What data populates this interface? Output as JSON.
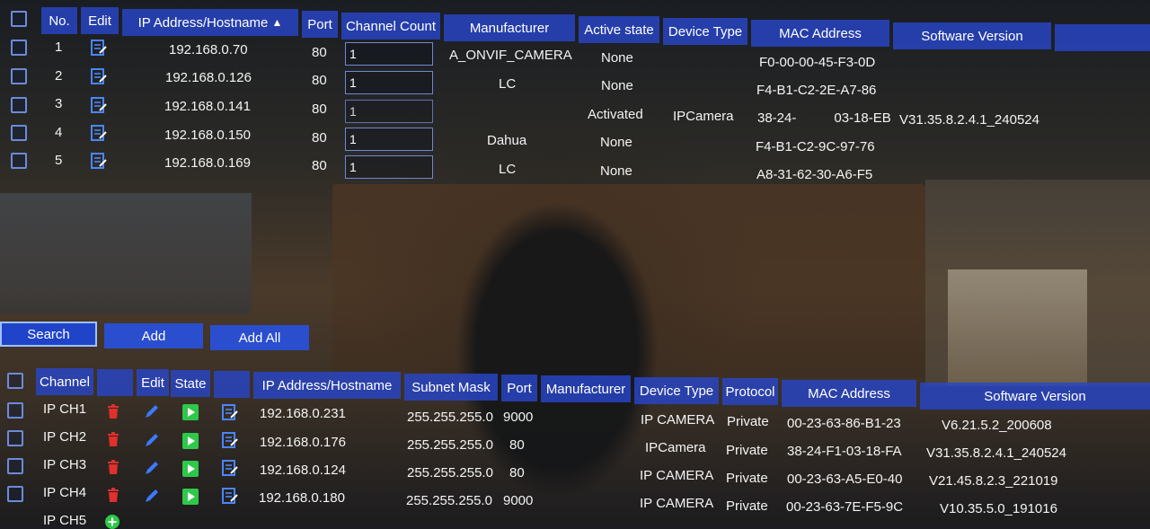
{
  "top_table": {
    "headers": {
      "no": "No.",
      "edit": "Edit",
      "ip": "IP Address/Hostname",
      "sort_arrow": "^",
      "port": "Port",
      "channel_count": "Channel Count",
      "manufacturer": "Manufacturer",
      "active_state": "Active state",
      "device_type": "Device Type",
      "mac": "MAC Address",
      "software": "Software Version"
    },
    "rows": [
      {
        "no": "1",
        "ip": "192.168.0.70",
        "port": "80",
        "channel_count": "1",
        "manufacturer": "A_ONVIF_CAMERA",
        "active": "None",
        "device_type": "",
        "mac": "F0-00-00-45-F3-0D",
        "software": ""
      },
      {
        "no": "2",
        "ip": "192.168.0.126",
        "port": "80",
        "channel_count": "1",
        "manufacturer": "LC",
        "active": "None",
        "device_type": "",
        "mac": "F4-B1-C2-2E-A7-86",
        "software": ""
      },
      {
        "no": "3",
        "ip": "192.168.0.141",
        "port": "80",
        "channel_count": "1",
        "manufacturer": "",
        "active": "Activated",
        "device_type": "IPCamera",
        "mac": "38-24-",
        "mac_b": "03-18-EB",
        "software": "V31.35.8.2.4.1_240524"
      },
      {
        "no": "4",
        "ip": "192.168.0.150",
        "port": "80",
        "channel_count": "1",
        "manufacturer": "Dahua",
        "active": "None",
        "device_type": "",
        "mac": "F4-B1-C2-9C-97-76",
        "software": ""
      },
      {
        "no": "5",
        "ip": "192.168.0.169",
        "port": "80",
        "channel_count": "1",
        "manufacturer": "LC",
        "active": "None",
        "device_type": "",
        "mac": "A8-31-62-30-A6-F5",
        "software": ""
      }
    ]
  },
  "buttons": {
    "search": "Search",
    "add": "Add",
    "add_all": "Add All"
  },
  "bottom_table": {
    "headers": {
      "channel": "Channel",
      "edit": "Edit",
      "state": "State",
      "ip": "IP Address/Hostname",
      "subnet": "Subnet Mask",
      "port": "Port",
      "manufacturer": "Manufacturer",
      "device_type": "Device Type",
      "protocol": "Protocol",
      "mac": "MAC Address",
      "software": "Software Version"
    },
    "rows": [
      {
        "channel": "IP CH1",
        "ip": "192.168.0.231",
        "subnet": "255.255.255.0",
        "port": "9000",
        "device_type": "IP CAMERA",
        "protocol": "Private",
        "mac": "00-23-63-86-B1-23",
        "software": "V6.21.5.2_200608"
      },
      {
        "channel": "IP CH2",
        "ip": "192.168.0.176",
        "subnet": "255.255.255.0",
        "port": "80",
        "device_type": "IPCamera",
        "protocol": "Private",
        "mac": "38-24-F1-03-18-FA",
        "software": "V31.35.8.2.4.1_240524"
      },
      {
        "channel": "IP CH3",
        "ip": "192.168.0.124",
        "subnet": "255.255.255.0",
        "port": "80",
        "device_type": "IP CAMERA",
        "protocol": "Private",
        "mac": "00-23-63-A5-E0-40",
        "software": "V21.45.8.2.3_221019"
      },
      {
        "channel": "IP CH4",
        "ip": "192.168.0.180",
        "subnet": "255.255.255.0",
        "port": "9000",
        "device_type": "IP CAMERA",
        "protocol": "Private",
        "mac": "00-23-63-7E-F5-9C",
        "software": "V10.35.5.0_191016"
      },
      {
        "channel": "IP CH5"
      }
    ]
  },
  "colors": {
    "header_bg": "#2846c8",
    "accent": "#2fc84a",
    "delete": "#e0302a",
    "icon_blue": "#3a7bff"
  }
}
